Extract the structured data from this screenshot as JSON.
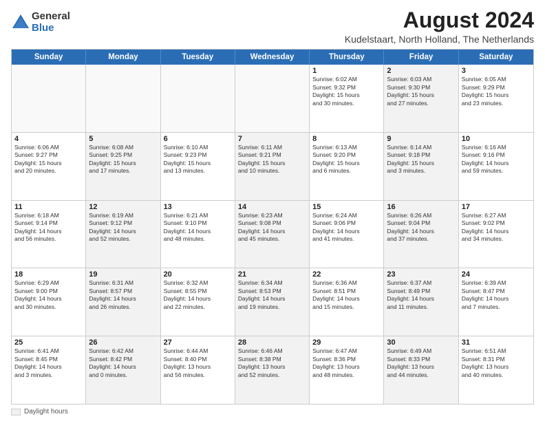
{
  "logo": {
    "general": "General",
    "blue": "Blue"
  },
  "title": "August 2024",
  "subtitle": "Kudelstaart, North Holland, The Netherlands",
  "header_days": [
    "Sunday",
    "Monday",
    "Tuesday",
    "Wednesday",
    "Thursday",
    "Friday",
    "Saturday"
  ],
  "legend_label": "Daylight hours",
  "weeks": [
    [
      {
        "day": "",
        "info": "",
        "empty": true
      },
      {
        "day": "",
        "info": "",
        "empty": true
      },
      {
        "day": "",
        "info": "",
        "empty": true
      },
      {
        "day": "",
        "info": "",
        "empty": true
      },
      {
        "day": "1",
        "info": "Sunrise: 6:02 AM\nSunset: 9:32 PM\nDaylight: 15 hours\nand 30 minutes.",
        "empty": false
      },
      {
        "day": "2",
        "info": "Sunrise: 6:03 AM\nSunset: 9:30 PM\nDaylight: 15 hours\nand 27 minutes.",
        "empty": false,
        "shaded": true
      },
      {
        "day": "3",
        "info": "Sunrise: 6:05 AM\nSunset: 9:29 PM\nDaylight: 15 hours\nand 23 minutes.",
        "empty": false
      }
    ],
    [
      {
        "day": "4",
        "info": "Sunrise: 6:06 AM\nSunset: 9:27 PM\nDaylight: 15 hours\nand 20 minutes.",
        "empty": false
      },
      {
        "day": "5",
        "info": "Sunrise: 6:08 AM\nSunset: 9:25 PM\nDaylight: 15 hours\nand 17 minutes.",
        "empty": false,
        "shaded": true
      },
      {
        "day": "6",
        "info": "Sunrise: 6:10 AM\nSunset: 9:23 PM\nDaylight: 15 hours\nand 13 minutes.",
        "empty": false
      },
      {
        "day": "7",
        "info": "Sunrise: 6:11 AM\nSunset: 9:21 PM\nDaylight: 15 hours\nand 10 minutes.",
        "empty": false,
        "shaded": true
      },
      {
        "day": "8",
        "info": "Sunrise: 6:13 AM\nSunset: 9:20 PM\nDaylight: 15 hours\nand 6 minutes.",
        "empty": false
      },
      {
        "day": "9",
        "info": "Sunrise: 6:14 AM\nSunset: 9:18 PM\nDaylight: 15 hours\nand 3 minutes.",
        "empty": false,
        "shaded": true
      },
      {
        "day": "10",
        "info": "Sunrise: 6:16 AM\nSunset: 9:16 PM\nDaylight: 14 hours\nand 59 minutes.",
        "empty": false
      }
    ],
    [
      {
        "day": "11",
        "info": "Sunrise: 6:18 AM\nSunset: 9:14 PM\nDaylight: 14 hours\nand 56 minutes.",
        "empty": false
      },
      {
        "day": "12",
        "info": "Sunrise: 6:19 AM\nSunset: 9:12 PM\nDaylight: 14 hours\nand 52 minutes.",
        "empty": false,
        "shaded": true
      },
      {
        "day": "13",
        "info": "Sunrise: 6:21 AM\nSunset: 9:10 PM\nDaylight: 14 hours\nand 48 minutes.",
        "empty": false
      },
      {
        "day": "14",
        "info": "Sunrise: 6:23 AM\nSunset: 9:08 PM\nDaylight: 14 hours\nand 45 minutes.",
        "empty": false,
        "shaded": true
      },
      {
        "day": "15",
        "info": "Sunrise: 6:24 AM\nSunset: 9:06 PM\nDaylight: 14 hours\nand 41 minutes.",
        "empty": false
      },
      {
        "day": "16",
        "info": "Sunrise: 6:26 AM\nSunset: 9:04 PM\nDaylight: 14 hours\nand 37 minutes.",
        "empty": false,
        "shaded": true
      },
      {
        "day": "17",
        "info": "Sunrise: 6:27 AM\nSunset: 9:02 PM\nDaylight: 14 hours\nand 34 minutes.",
        "empty": false
      }
    ],
    [
      {
        "day": "18",
        "info": "Sunrise: 6:29 AM\nSunset: 9:00 PM\nDaylight: 14 hours\nand 30 minutes.",
        "empty": false
      },
      {
        "day": "19",
        "info": "Sunrise: 6:31 AM\nSunset: 8:57 PM\nDaylight: 14 hours\nand 26 minutes.",
        "empty": false,
        "shaded": true
      },
      {
        "day": "20",
        "info": "Sunrise: 6:32 AM\nSunset: 8:55 PM\nDaylight: 14 hours\nand 22 minutes.",
        "empty": false
      },
      {
        "day": "21",
        "info": "Sunrise: 6:34 AM\nSunset: 8:53 PM\nDaylight: 14 hours\nand 19 minutes.",
        "empty": false,
        "shaded": true
      },
      {
        "day": "22",
        "info": "Sunrise: 6:36 AM\nSunset: 8:51 PM\nDaylight: 14 hours\nand 15 minutes.",
        "empty": false
      },
      {
        "day": "23",
        "info": "Sunrise: 6:37 AM\nSunset: 8:49 PM\nDaylight: 14 hours\nand 11 minutes.",
        "empty": false,
        "shaded": true
      },
      {
        "day": "24",
        "info": "Sunrise: 6:39 AM\nSunset: 8:47 PM\nDaylight: 14 hours\nand 7 minutes.",
        "empty": false
      }
    ],
    [
      {
        "day": "25",
        "info": "Sunrise: 6:41 AM\nSunset: 8:45 PM\nDaylight: 14 hours\nand 3 minutes.",
        "empty": false
      },
      {
        "day": "26",
        "info": "Sunrise: 6:42 AM\nSunset: 8:42 PM\nDaylight: 14 hours\nand 0 minutes.",
        "empty": false,
        "shaded": true
      },
      {
        "day": "27",
        "info": "Sunrise: 6:44 AM\nSunset: 8:40 PM\nDaylight: 13 hours\nand 56 minutes.",
        "empty": false
      },
      {
        "day": "28",
        "info": "Sunrise: 6:46 AM\nSunset: 8:38 PM\nDaylight: 13 hours\nand 52 minutes.",
        "empty": false,
        "shaded": true
      },
      {
        "day": "29",
        "info": "Sunrise: 6:47 AM\nSunset: 8:36 PM\nDaylight: 13 hours\nand 48 minutes.",
        "empty": false
      },
      {
        "day": "30",
        "info": "Sunrise: 6:49 AM\nSunset: 8:33 PM\nDaylight: 13 hours\nand 44 minutes.",
        "empty": false,
        "shaded": true
      },
      {
        "day": "31",
        "info": "Sunrise: 6:51 AM\nSunset: 8:31 PM\nDaylight: 13 hours\nand 40 minutes.",
        "empty": false
      }
    ]
  ]
}
